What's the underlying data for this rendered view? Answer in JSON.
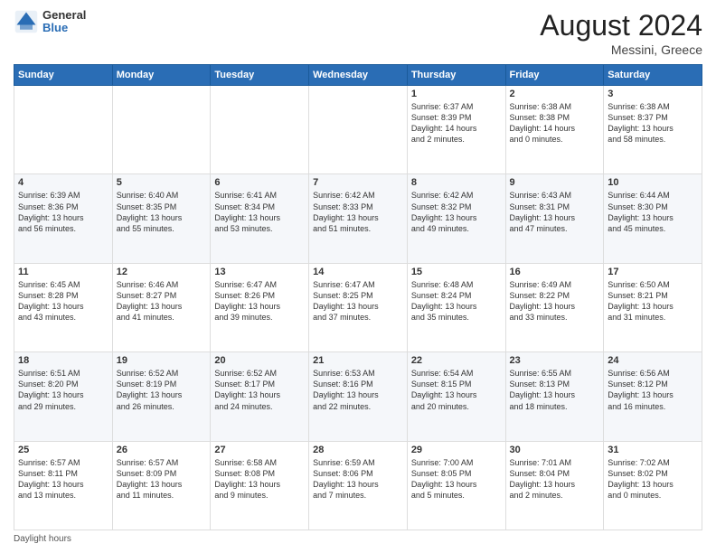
{
  "header": {
    "logo_general": "General",
    "logo_blue": "Blue",
    "month_title": "August 2024",
    "subtitle": "Messini, Greece"
  },
  "footer": {
    "note": "Daylight hours"
  },
  "weekdays": [
    "Sunday",
    "Monday",
    "Tuesday",
    "Wednesday",
    "Thursday",
    "Friday",
    "Saturday"
  ],
  "weeks": [
    [
      {
        "day": "",
        "info": ""
      },
      {
        "day": "",
        "info": ""
      },
      {
        "day": "",
        "info": ""
      },
      {
        "day": "",
        "info": ""
      },
      {
        "day": "1",
        "info": "Sunrise: 6:37 AM\nSunset: 8:39 PM\nDaylight: 14 hours\nand 2 minutes."
      },
      {
        "day": "2",
        "info": "Sunrise: 6:38 AM\nSunset: 8:38 PM\nDaylight: 14 hours\nand 0 minutes."
      },
      {
        "day": "3",
        "info": "Sunrise: 6:38 AM\nSunset: 8:37 PM\nDaylight: 13 hours\nand 58 minutes."
      }
    ],
    [
      {
        "day": "4",
        "info": "Sunrise: 6:39 AM\nSunset: 8:36 PM\nDaylight: 13 hours\nand 56 minutes."
      },
      {
        "day": "5",
        "info": "Sunrise: 6:40 AM\nSunset: 8:35 PM\nDaylight: 13 hours\nand 55 minutes."
      },
      {
        "day": "6",
        "info": "Sunrise: 6:41 AM\nSunset: 8:34 PM\nDaylight: 13 hours\nand 53 minutes."
      },
      {
        "day": "7",
        "info": "Sunrise: 6:42 AM\nSunset: 8:33 PM\nDaylight: 13 hours\nand 51 minutes."
      },
      {
        "day": "8",
        "info": "Sunrise: 6:42 AM\nSunset: 8:32 PM\nDaylight: 13 hours\nand 49 minutes."
      },
      {
        "day": "9",
        "info": "Sunrise: 6:43 AM\nSunset: 8:31 PM\nDaylight: 13 hours\nand 47 minutes."
      },
      {
        "day": "10",
        "info": "Sunrise: 6:44 AM\nSunset: 8:30 PM\nDaylight: 13 hours\nand 45 minutes."
      }
    ],
    [
      {
        "day": "11",
        "info": "Sunrise: 6:45 AM\nSunset: 8:28 PM\nDaylight: 13 hours\nand 43 minutes."
      },
      {
        "day": "12",
        "info": "Sunrise: 6:46 AM\nSunset: 8:27 PM\nDaylight: 13 hours\nand 41 minutes."
      },
      {
        "day": "13",
        "info": "Sunrise: 6:47 AM\nSunset: 8:26 PM\nDaylight: 13 hours\nand 39 minutes."
      },
      {
        "day": "14",
        "info": "Sunrise: 6:47 AM\nSunset: 8:25 PM\nDaylight: 13 hours\nand 37 minutes."
      },
      {
        "day": "15",
        "info": "Sunrise: 6:48 AM\nSunset: 8:24 PM\nDaylight: 13 hours\nand 35 minutes."
      },
      {
        "day": "16",
        "info": "Sunrise: 6:49 AM\nSunset: 8:22 PM\nDaylight: 13 hours\nand 33 minutes."
      },
      {
        "day": "17",
        "info": "Sunrise: 6:50 AM\nSunset: 8:21 PM\nDaylight: 13 hours\nand 31 minutes."
      }
    ],
    [
      {
        "day": "18",
        "info": "Sunrise: 6:51 AM\nSunset: 8:20 PM\nDaylight: 13 hours\nand 29 minutes."
      },
      {
        "day": "19",
        "info": "Sunrise: 6:52 AM\nSunset: 8:19 PM\nDaylight: 13 hours\nand 26 minutes."
      },
      {
        "day": "20",
        "info": "Sunrise: 6:52 AM\nSunset: 8:17 PM\nDaylight: 13 hours\nand 24 minutes."
      },
      {
        "day": "21",
        "info": "Sunrise: 6:53 AM\nSunset: 8:16 PM\nDaylight: 13 hours\nand 22 minutes."
      },
      {
        "day": "22",
        "info": "Sunrise: 6:54 AM\nSunset: 8:15 PM\nDaylight: 13 hours\nand 20 minutes."
      },
      {
        "day": "23",
        "info": "Sunrise: 6:55 AM\nSunset: 8:13 PM\nDaylight: 13 hours\nand 18 minutes."
      },
      {
        "day": "24",
        "info": "Sunrise: 6:56 AM\nSunset: 8:12 PM\nDaylight: 13 hours\nand 16 minutes."
      }
    ],
    [
      {
        "day": "25",
        "info": "Sunrise: 6:57 AM\nSunset: 8:11 PM\nDaylight: 13 hours\nand 13 minutes."
      },
      {
        "day": "26",
        "info": "Sunrise: 6:57 AM\nSunset: 8:09 PM\nDaylight: 13 hours\nand 11 minutes."
      },
      {
        "day": "27",
        "info": "Sunrise: 6:58 AM\nSunset: 8:08 PM\nDaylight: 13 hours\nand 9 minutes."
      },
      {
        "day": "28",
        "info": "Sunrise: 6:59 AM\nSunset: 8:06 PM\nDaylight: 13 hours\nand 7 minutes."
      },
      {
        "day": "29",
        "info": "Sunrise: 7:00 AM\nSunset: 8:05 PM\nDaylight: 13 hours\nand 5 minutes."
      },
      {
        "day": "30",
        "info": "Sunrise: 7:01 AM\nSunset: 8:04 PM\nDaylight: 13 hours\nand 2 minutes."
      },
      {
        "day": "31",
        "info": "Sunrise: 7:02 AM\nSunset: 8:02 PM\nDaylight: 13 hours\nand 0 minutes."
      }
    ]
  ]
}
